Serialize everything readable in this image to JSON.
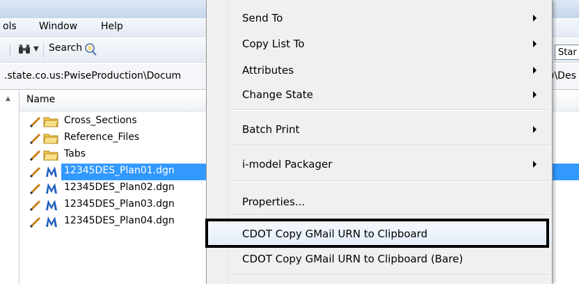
{
  "menubar": {
    "items": [
      "ols",
      "Window",
      "Help"
    ]
  },
  "toolbar": {
    "search_label": "Search",
    "start_label": "Star"
  },
  "pathbar": {
    "left": ".state.co.us:PwiseProduction\\Docum",
    "right": ")\\Des"
  },
  "list": {
    "header": "Name",
    "rows": [
      {
        "label": "Cross_Sections",
        "kind": "folder"
      },
      {
        "label": "Reference_Files",
        "kind": "folder"
      },
      {
        "label": "Tabs",
        "kind": "folder"
      },
      {
        "label": "12345DES_Plan01.dgn",
        "kind": "dgn",
        "selected": true
      },
      {
        "label": "12345DES_Plan02.dgn",
        "kind": "dgn"
      },
      {
        "label": "12345DES_Plan03.dgn",
        "kind": "dgn"
      },
      {
        "label": "12345DES_Plan04.dgn",
        "kind": "dgn"
      }
    ]
  },
  "context_menu": {
    "items": [
      {
        "label": "Send To",
        "submenu": true
      },
      {
        "label": "Copy List To",
        "submenu": true
      },
      {
        "label": "Attributes",
        "submenu": true
      },
      {
        "label": "Change State",
        "submenu": true
      },
      {
        "label": "Batch Print",
        "submenu": true
      },
      {
        "label": "i-model Packager",
        "submenu": true
      },
      {
        "label": "Properties...",
        "submenu": false
      },
      {
        "label": "CDOT Copy GMail URN to Clipboard",
        "submenu": false,
        "highlighted": true
      },
      {
        "label": "CDOT Copy GMail URN to Clipboard (Bare)",
        "submenu": false
      }
    ]
  },
  "colors": {
    "selection": "#3399ff",
    "menu_bg": "#f0f0f0",
    "folder": "#f5c84a",
    "dgn_icon": "#1f5fbf"
  }
}
